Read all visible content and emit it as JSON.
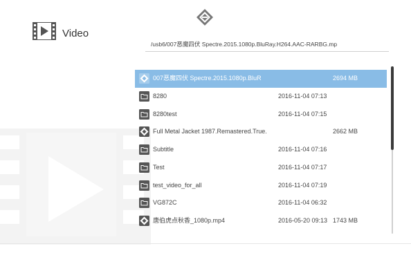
{
  "app": {
    "title": "Video"
  },
  "path": "/usb6/007恶魔四伏 Spectre.2015.1080p.BluRay.H264.AAC-RARBG.mp",
  "files": [
    {
      "type": "video",
      "name": "007恶魔四伏 Spectre.2015.1080p.BluR",
      "date": "",
      "size": "2694 MB",
      "selected": true
    },
    {
      "type": "folder",
      "name": "8280",
      "date": "2016-11-04 07:13",
      "size": ""
    },
    {
      "type": "folder",
      "name": "8280test",
      "date": "2016-11-04 07:15",
      "size": ""
    },
    {
      "type": "video",
      "name": "Full Metal Jacket 1987.Remastered.True.",
      "date": "",
      "size": "2662 MB"
    },
    {
      "type": "folder",
      "name": "Subtitle",
      "date": "2016-11-04 07:16",
      "size": ""
    },
    {
      "type": "folder",
      "name": "Test",
      "date": "2016-11-04 07:17",
      "size": ""
    },
    {
      "type": "folder",
      "name": "test_video_for_all",
      "date": "2016-11-04 07:19",
      "size": ""
    },
    {
      "type": "folder",
      "name": "VG872C",
      "date": "2016-11-04 06:32",
      "size": ""
    },
    {
      "type": "video",
      "name": "唐伯虎点秋香_1080p.mp4",
      "date": "2016-05-20 09:13",
      "size": "1743 MB"
    }
  ],
  "scrollbar": {
    "position_fraction": 0.0,
    "visible_fraction": 0.5
  },
  "colors": {
    "selection": "#89bce6",
    "icon": "#555555"
  }
}
